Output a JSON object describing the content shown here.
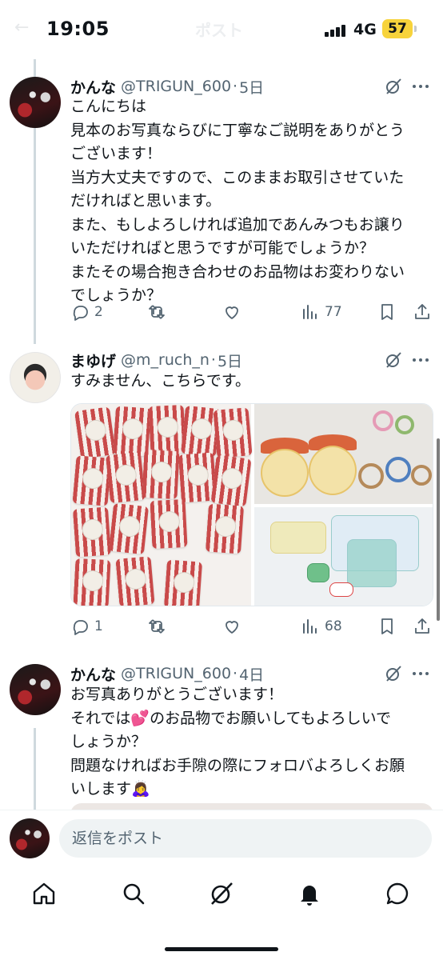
{
  "status_bar": {
    "time": "19:05",
    "network": "4G",
    "battery": "57",
    "back_glyph": "←",
    "screen_title": "ポスト"
  },
  "tweets": [
    {
      "name": "かんな",
      "handle": "@TRIGUN_600",
      "separator": "·",
      "date": "5日",
      "text": "こんにちは\n見本のお写真ならびに丁寧なご説明をありがとう\nございます！\n当方大丈夫ですので、このままお取引させていた\nだければと思います。\nまた、もしよろしければ追加であんみつもお譲り\nいただければと思うですが可能でしょうか？\nまたその場合抱き合わせのお品物はお変わりない\nでしょうか？",
      "replies": "2",
      "retweets": "",
      "likes": "",
      "views": "77"
    },
    {
      "name": "まゆげ",
      "handle": "@m_ruch_n",
      "separator": "·",
      "date": "5日",
      "text": "すみません、こちらです。",
      "replies": "1",
      "retweets": "",
      "likes": "",
      "views": "68"
    },
    {
      "name": "かんな",
      "handle": "@TRIGUN_600",
      "separator": "·",
      "date": "4日",
      "text": "お写真ありがとうございます！\nそれでは💕のお品物でお願いしてもよろしいで\nしょうか？\n問題なければお手隙の際にフォロバよろしくお願\nいします🙇‍♀️"
    }
  ],
  "reply_bar": {
    "placeholder": "返信をポスト"
  },
  "nav": [
    "home-icon",
    "search-icon",
    "grok-icon",
    "notifications-icon",
    "messages-icon"
  ],
  "colors": {
    "text_primary": "#0f1419",
    "text_secondary": "#536471",
    "thread_line": "#cfd9de",
    "battery": "#f7d33b"
  }
}
